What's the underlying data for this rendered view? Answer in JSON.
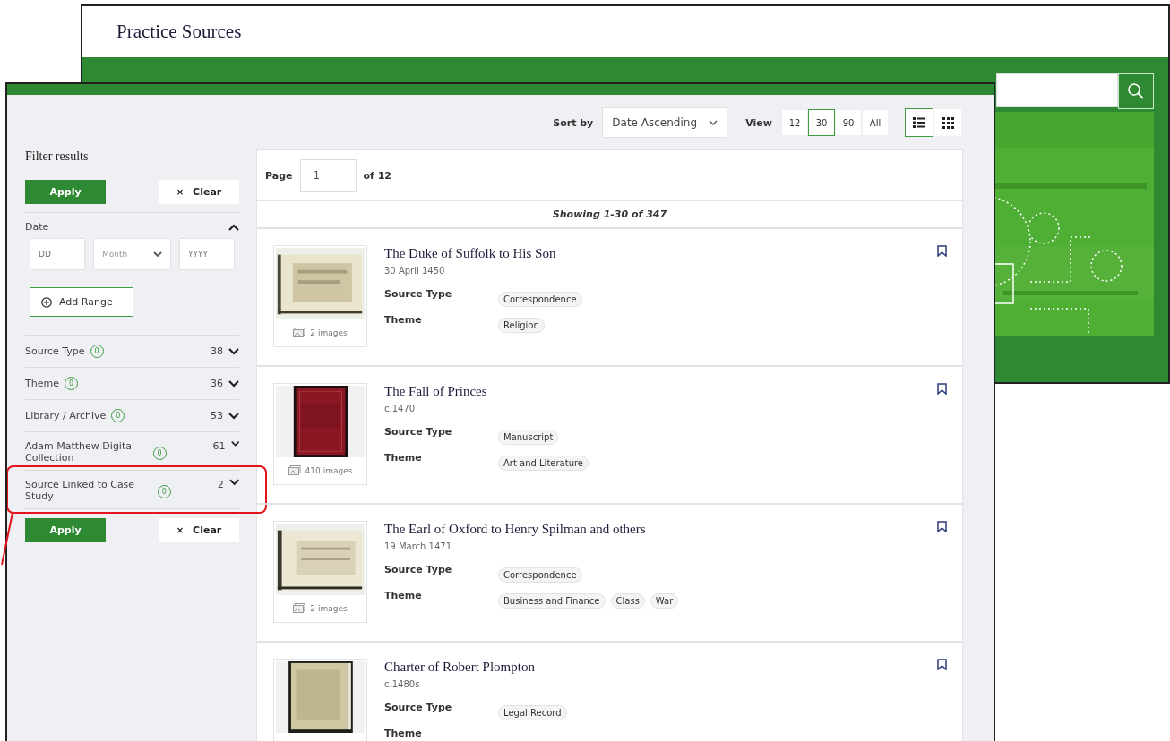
{
  "back_window": {
    "title": "Practice Sources"
  },
  "front_window": {
    "toolbar": {
      "sort_label": "Sort by",
      "sort_value": "Date Ascending",
      "view_label": "View",
      "page_sizes": [
        {
          "label": "12",
          "selected": false
        },
        {
          "label": "30",
          "selected": true
        },
        {
          "label": "90",
          "selected": false
        },
        {
          "label": "All",
          "selected": false
        }
      ],
      "layouts": [
        {
          "kind": "list",
          "selected": true
        },
        {
          "kind": "grid",
          "selected": false
        }
      ]
    },
    "filters": {
      "title": "Filter results",
      "top_actions": {
        "apply": "Apply",
        "clear_icon": "×",
        "clear": "Clear"
      },
      "date": {
        "label": "Date",
        "expanded": true,
        "day_placeholder": "DD",
        "month_placeholder": "Month",
        "year_placeholder": "YYYY",
        "add_range": "Add Range"
      },
      "facets": [
        {
          "label": "Source Type",
          "badge": "0",
          "count": "38",
          "highlighted": false
        },
        {
          "label": "Theme",
          "badge": "0",
          "count": "36",
          "highlighted": false
        },
        {
          "label": "Library / Archive",
          "badge": "0",
          "count": "53",
          "highlighted": false
        },
        {
          "label": "Adam Matthew Digital Collection",
          "badge": "0",
          "count": "61",
          "highlighted": false
        },
        {
          "label": "Source Linked to Case Study",
          "badge": "0",
          "count": "2",
          "highlighted": true
        }
      ],
      "bottom_actions": {
        "apply": "Apply",
        "clear_icon": "×",
        "clear": "Clear"
      }
    },
    "pagination": {
      "page_label": "Page",
      "page_value": "1",
      "total": "of 12"
    },
    "showing": "Showing 1-30 of 347",
    "results": [
      {
        "title": "The Duke of Suffolk to His Son",
        "date": "30 April 1450",
        "images": "2 images",
        "source_type_label": "Source Type",
        "source_types": [
          "Correspondence"
        ],
        "theme_label": "Theme",
        "themes": [
          "Religion"
        ]
      },
      {
        "title": "The Fall of Princes",
        "date": "c.1470",
        "images": "410 images",
        "source_type_label": "Source Type",
        "source_types": [
          "Manuscript"
        ],
        "theme_label": "Theme",
        "themes": [
          "Art and Literature"
        ]
      },
      {
        "title": "The Earl of Oxford to Henry Spilman and others",
        "date": "19 March 1471",
        "images": "2 images",
        "source_type_label": "Source Type",
        "source_types": [
          "Correspondence"
        ],
        "theme_label": "Theme",
        "themes": [
          "Business and Finance",
          "Class",
          "War"
        ]
      },
      {
        "title": "Charter of Robert Plompton",
        "date": "c.1480s",
        "source_type_label": "Source Type",
        "source_types": [
          "Legal Record"
        ],
        "theme_label": "Theme"
      }
    ]
  }
}
